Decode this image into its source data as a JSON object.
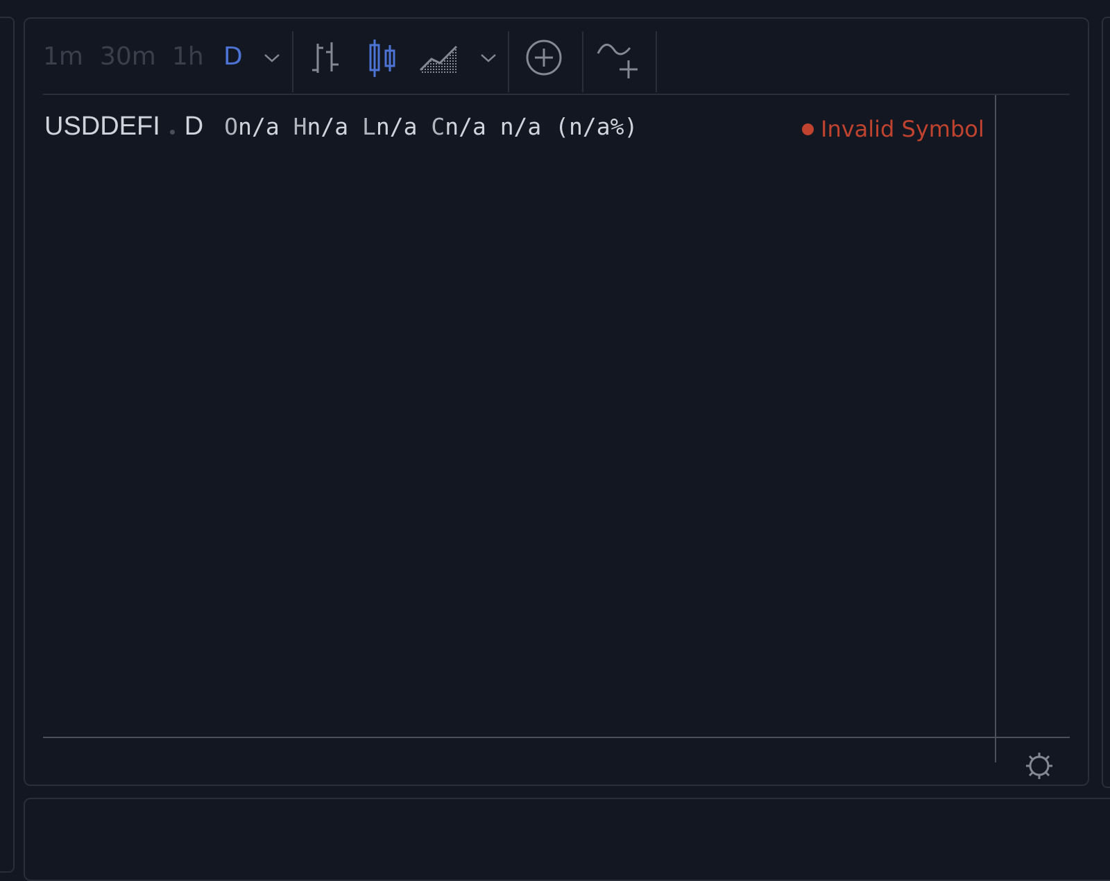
{
  "toolbar": {
    "timeframes": [
      "1m",
      "30m",
      "1h",
      "D"
    ],
    "active_timeframe": "D"
  },
  "legend": {
    "symbol": "USDDEFI",
    "interval": "D",
    "open_label": "O",
    "open_value": "n/a",
    "high_label": "H",
    "high_value": "n/a",
    "low_label": "L",
    "low_value": "n/a",
    "close_label": "C",
    "close_value": "n/a",
    "change": "n/a (n/a%)"
  },
  "status": {
    "text": "Invalid Symbol",
    "color": "#c0432f"
  },
  "colors": {
    "background": "#131722",
    "accent": "#4d73d4",
    "border": "#2a2e39"
  },
  "icons": {
    "bars": "bar-chart-icon",
    "candles": "candlestick-icon",
    "area": "area-chart-icon",
    "compare": "add-symbol-icon",
    "indicators": "indicators-icon",
    "settings": "gear-icon"
  }
}
